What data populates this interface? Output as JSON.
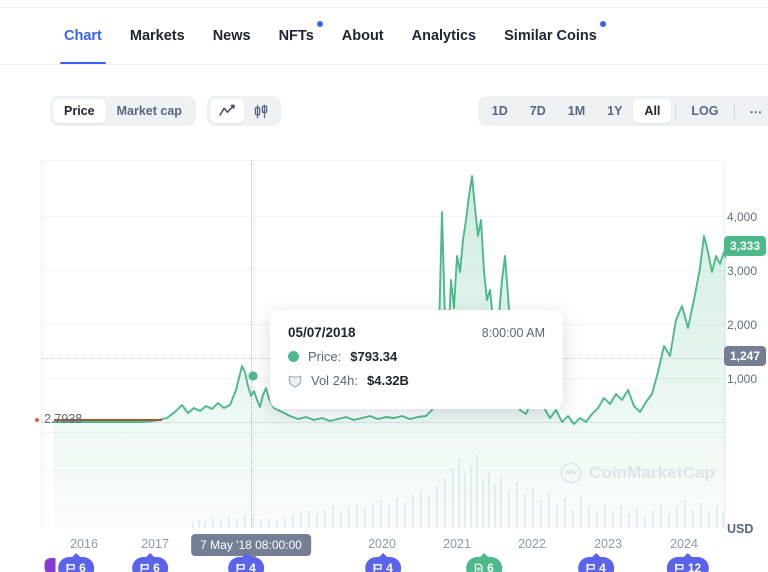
{
  "tabs": [
    {
      "label": "Chart",
      "active": true,
      "badge": false
    },
    {
      "label": "Markets",
      "active": false,
      "badge": false
    },
    {
      "label": "News",
      "active": false,
      "badge": false
    },
    {
      "label": "NFTs",
      "active": false,
      "badge": true
    },
    {
      "label": "About",
      "active": false,
      "badge": false
    },
    {
      "label": "Analytics",
      "active": false,
      "badge": false
    },
    {
      "label": "Similar Coins",
      "active": false,
      "badge": true
    }
  ],
  "toolbar": {
    "metric_options": [
      {
        "label": "Price",
        "active": true
      },
      {
        "label": "Market cap",
        "active": false
      }
    ],
    "chart_type_options": [
      {
        "icon": "line-chart-icon",
        "active": true
      },
      {
        "icon": "candlestick-icon",
        "active": false
      }
    ],
    "ranges": [
      {
        "label": "1D",
        "active": false
      },
      {
        "label": "7D",
        "active": false
      },
      {
        "label": "1M",
        "active": false
      },
      {
        "label": "1Y",
        "active": false
      },
      {
        "label": "All",
        "active": true
      }
    ],
    "log_label": "LOG",
    "more_label": "⋯"
  },
  "tooltip": {
    "date": "05/07/2018",
    "time": "8:00:00 AM",
    "price_label": "Price:",
    "price_value": "$793.34",
    "volume_label": "Vol 24h:",
    "volume_value": "$4.32B"
  },
  "axis": {
    "y_unit": "USD",
    "y_ticks": [
      "4,000",
      "3,000",
      "2,000",
      "1,000"
    ],
    "current_price_badge": "3,333",
    "crosshair_price_badge": "1,247",
    "low_marker_label": "2.7938",
    "x_ticks": [
      "2016",
      "2017",
      "2020",
      "2021",
      "2022",
      "2023",
      "2024"
    ],
    "crosshair_date_badge": "7 May '18 08:00:00"
  },
  "events": [
    {
      "year": "2016",
      "count": "6",
      "icon": "flag-icon",
      "color": "blue"
    },
    {
      "year": "2017",
      "count": "6",
      "icon": "flag-icon",
      "color": "blue"
    },
    {
      "year": "2018",
      "count": "4",
      "icon": "flag-icon",
      "color": "blue"
    },
    {
      "year": "2020",
      "count": "4",
      "icon": "flag-icon",
      "color": "blue"
    },
    {
      "year": "2021",
      "count": "6",
      "icon": "document-icon",
      "color": "green"
    },
    {
      "year": "2023",
      "count": "4",
      "icon": "flag-icon",
      "color": "blue"
    },
    {
      "year": "2024",
      "count": "12",
      "icon": "flag-icon",
      "color": "blue"
    }
  ],
  "watermark": {
    "text": "CoinMarketCap"
  },
  "colors": {
    "accent": "#3861fb",
    "line": "#4bb98a",
    "badge_slate": "#747e94",
    "event_blue": "#5a63ea",
    "low_marker": "#a9543c"
  },
  "chart_data": {
    "type": "area",
    "title": "",
    "xlabel": "",
    "ylabel": "USD",
    "ylim": [
      0,
      4500
    ],
    "grid": true,
    "legend": "none",
    "series": [
      {
        "name": "Price",
        "unit": "USD",
        "x": [
          "2015",
          "2016",
          "2017-01",
          "2017-06",
          "2017-12",
          "2018-01",
          "2018-05-07",
          "2018-12",
          "2019-06",
          "2020-03",
          "2020-12",
          "2021-05",
          "2021-08",
          "2021-11",
          "2022-06",
          "2022-12",
          "2023-06",
          "2023-12",
          "2024-03",
          "2024-12"
        ],
        "values": [
          2.79,
          8,
          10,
          300,
          760,
          1100,
          793.34,
          140,
          300,
          130,
          730,
          4100,
          3200,
          4600,
          1100,
          1200,
          1850,
          2300,
          3900,
          3333
        ]
      },
      {
        "name": "Volume 24h",
        "unit": "USD",
        "rendered_as": "light-gray-bars-bottom",
        "highlight_value": "$4.32B"
      }
    ],
    "annotations": [
      {
        "type": "crosshair",
        "x": "2018-05-07 08:00:00",
        "y_price": 793.34,
        "y_label": "1,247"
      },
      {
        "type": "low-marker",
        "value": 2.7938,
        "label": "2.7938"
      },
      {
        "type": "current-price",
        "value": 3333,
        "label": "3,333"
      }
    ]
  }
}
